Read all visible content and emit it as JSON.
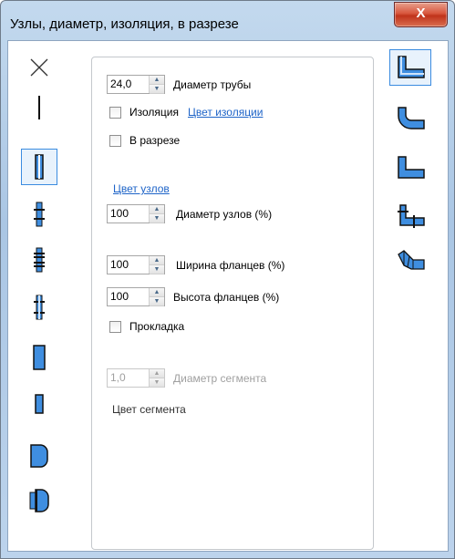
{
  "window": {
    "title": "Узлы, диаметр, изоляция, в разрезе",
    "close_label": "X"
  },
  "left_icons": [
    {
      "name": "none-cross-icon",
      "selected": false
    },
    {
      "name": "single-line-icon",
      "selected": false
    },
    {
      "name": "pipe-section-icon",
      "selected": true
    },
    {
      "name": "flanged-joint-icon",
      "selected": false
    },
    {
      "name": "flanged-joint-bolted-icon",
      "selected": false
    },
    {
      "name": "flanged-joint-narrow-icon",
      "selected": false
    },
    {
      "name": "pipe-rect-tall-icon",
      "selected": false
    },
    {
      "name": "pipe-rect-small-icon",
      "selected": false
    },
    {
      "name": "pipe-rounded-end-icon",
      "selected": false
    },
    {
      "name": "pipe-coupling-icon",
      "selected": false
    }
  ],
  "right_icons": [
    {
      "name": "elbow-sharp-icon",
      "selected": true
    },
    {
      "name": "elbow-rounded-icon",
      "selected": false
    },
    {
      "name": "elbow-square-icon",
      "selected": false
    },
    {
      "name": "elbow-flanged-icon",
      "selected": false
    },
    {
      "name": "elbow-segmented-icon",
      "selected": false
    }
  ],
  "pipe_diameter": {
    "value": "24,0",
    "label": "Диаметр трубы"
  },
  "insulation": {
    "label": "Изоляция",
    "checked": false,
    "color_link": "Цвет изоляции"
  },
  "cross_section": {
    "label": "В разрезе",
    "checked": false
  },
  "node_color_link": "Цвет узлов",
  "node_diameter": {
    "value": "100",
    "label": "Диаметр узлов (%)"
  },
  "flange_width": {
    "value": "100",
    "label": "Ширина фланцев (%)"
  },
  "flange_height": {
    "value": "100",
    "label": "Высота фланцев (%)"
  },
  "gasket": {
    "label": "Прокладка",
    "checked": false
  },
  "segment_diameter": {
    "value": "1,0",
    "label": "Диаметр сегмента",
    "disabled": true
  },
  "segment_color_label": "Цвет сегмента",
  "colors": {
    "accent_blue": "#1e64c8",
    "pipe_fill": "#3f8ee0",
    "selection_border": "#3b8ce0"
  }
}
